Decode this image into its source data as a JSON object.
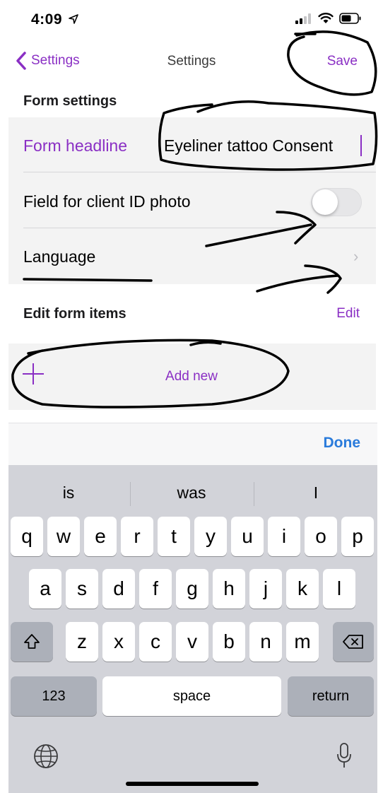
{
  "status_bar": {
    "time": "4:09"
  },
  "nav": {
    "back_label": "Settings",
    "title": "Settings",
    "save_label": "Save"
  },
  "form_settings": {
    "header": "Form settings",
    "headline_label": "Form headline",
    "headline_value": "Eyeliner tattoo Consent",
    "id_photo_label": "Field for client ID photo",
    "id_photo_enabled": false,
    "language_label": "Language"
  },
  "form_items": {
    "header": "Edit  form items",
    "edit_label": "Edit",
    "add_label": "Add new"
  },
  "keyboard": {
    "done_label": "Done",
    "suggestions": [
      "is",
      "was",
      "I"
    ],
    "row1": [
      "q",
      "w",
      "e",
      "r",
      "t",
      "y",
      "u",
      "i",
      "o",
      "p"
    ],
    "row2": [
      "a",
      "s",
      "d",
      "f",
      "g",
      "h",
      "j",
      "k",
      "l"
    ],
    "row3": [
      "z",
      "x",
      "c",
      "v",
      "b",
      "n",
      "m"
    ],
    "numbers_label": "123",
    "space_label": "space",
    "return_label": "return"
  },
  "colors": {
    "accent": "#8a2fc4",
    "done_blue": "#2a7bdb",
    "keyboard_bg": "#d2d3d9"
  }
}
